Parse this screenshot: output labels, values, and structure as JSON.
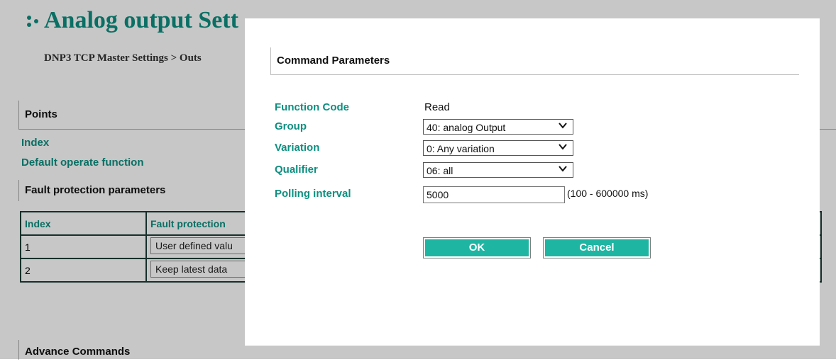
{
  "background": {
    "page_title": "Analog output Sett",
    "breadcrumb": "DNP3 TCP Master Settings > Outs",
    "points_section": "Points",
    "index_label": "Index",
    "default_operate_label": "Default operate function",
    "fault_section": "Fault protection parameters",
    "fault_table": {
      "headers": [
        "Index",
        "Fault protection"
      ],
      "rows": [
        {
          "index": "1",
          "value": "User defined valu"
        },
        {
          "index": "2",
          "value": "Keep latest data"
        }
      ]
    },
    "advance_section": "Advance Commands"
  },
  "modal": {
    "title": "Command Parameters",
    "function_code_label": "Function Code",
    "function_code_value": "Read",
    "group_label": "Group",
    "group_value": "40: analog Output",
    "variation_label": "Variation",
    "variation_value": "0: Any variation",
    "qualifier_label": "Qualifier",
    "qualifier_value": "06: all",
    "polling_label": "Polling interval",
    "polling_value": "5000",
    "polling_range": "(100 - 600000 ms)",
    "ok_label": "OK",
    "cancel_label": "Cancel"
  },
  "colors": {
    "accent": "#0d8f80",
    "button": "#1fb5a3",
    "overlay": "rgba(0,0,0,0.22)"
  }
}
